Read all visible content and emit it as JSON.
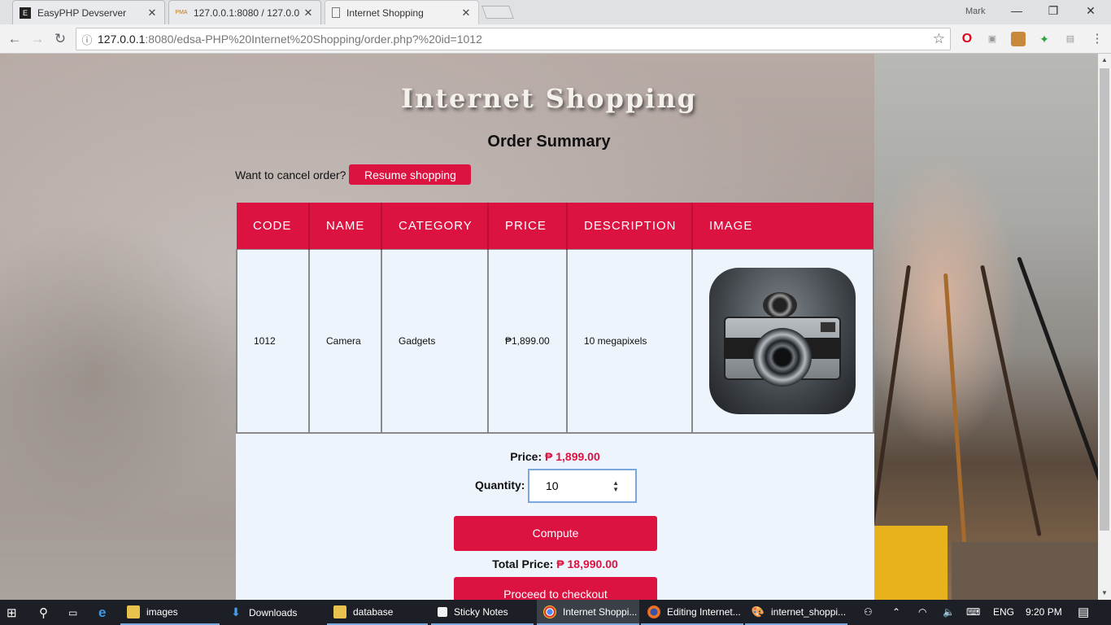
{
  "browser": {
    "tabs": [
      {
        "title": "EasyPHP Devserver",
        "favicon": "easyphp-icon"
      },
      {
        "title": "127.0.0.1:8080 / 127.0.0.1",
        "favicon": "phpmyadmin-icon",
        "favicon_text": "PMA"
      },
      {
        "title": "Internet Shopping",
        "favicon": "page-icon"
      }
    ],
    "profile_name": "Mark",
    "url_host": "127.0.0.1",
    "url_rest": ":8080/edsa-PHP%20Internet%20Shopping/order.php?%20id=1012"
  },
  "page": {
    "site_title": "Internet Shopping",
    "heading": "Order Summary",
    "cancel_prompt": "Want to cancel order?",
    "resume_label": "Resume shopping",
    "table": {
      "headers": [
        "CODE",
        "NAME",
        "CATEGORY",
        "PRICE",
        "DESCRIPTION",
        "IMAGE"
      ],
      "row": {
        "code": "1012",
        "name": "Camera",
        "category": "Gadgets",
        "price": "₱1,899.00",
        "description": "10 megapixels"
      }
    },
    "price_label": "Price:",
    "price_value": "₱ 1,899.00",
    "quantity_label": "Quantity:",
    "quantity_value": "10",
    "compute_label": "Compute",
    "total_label": "Total Price:",
    "total_value": "₱ 18,990.00",
    "checkout_label": "Proceed to checkout"
  },
  "colors": {
    "accent": "#dc1240",
    "panel": "#eef4fb"
  },
  "taskbar": {
    "items": [
      {
        "label": "images",
        "icon": "folder-icon"
      },
      {
        "label": "Downloads",
        "icon": "download-icon"
      },
      {
        "label": "database",
        "icon": "folder-icon"
      },
      {
        "label": "Sticky Notes",
        "icon": "sticky-notes-icon"
      },
      {
        "label": "Internet Shoppi...",
        "icon": "chrome-icon"
      },
      {
        "label": "Editing Internet...",
        "icon": "firefox-icon"
      },
      {
        "label": "internet_shoppi...",
        "icon": "paint-icon"
      }
    ],
    "language": "ENG",
    "time": "9:20 PM"
  }
}
